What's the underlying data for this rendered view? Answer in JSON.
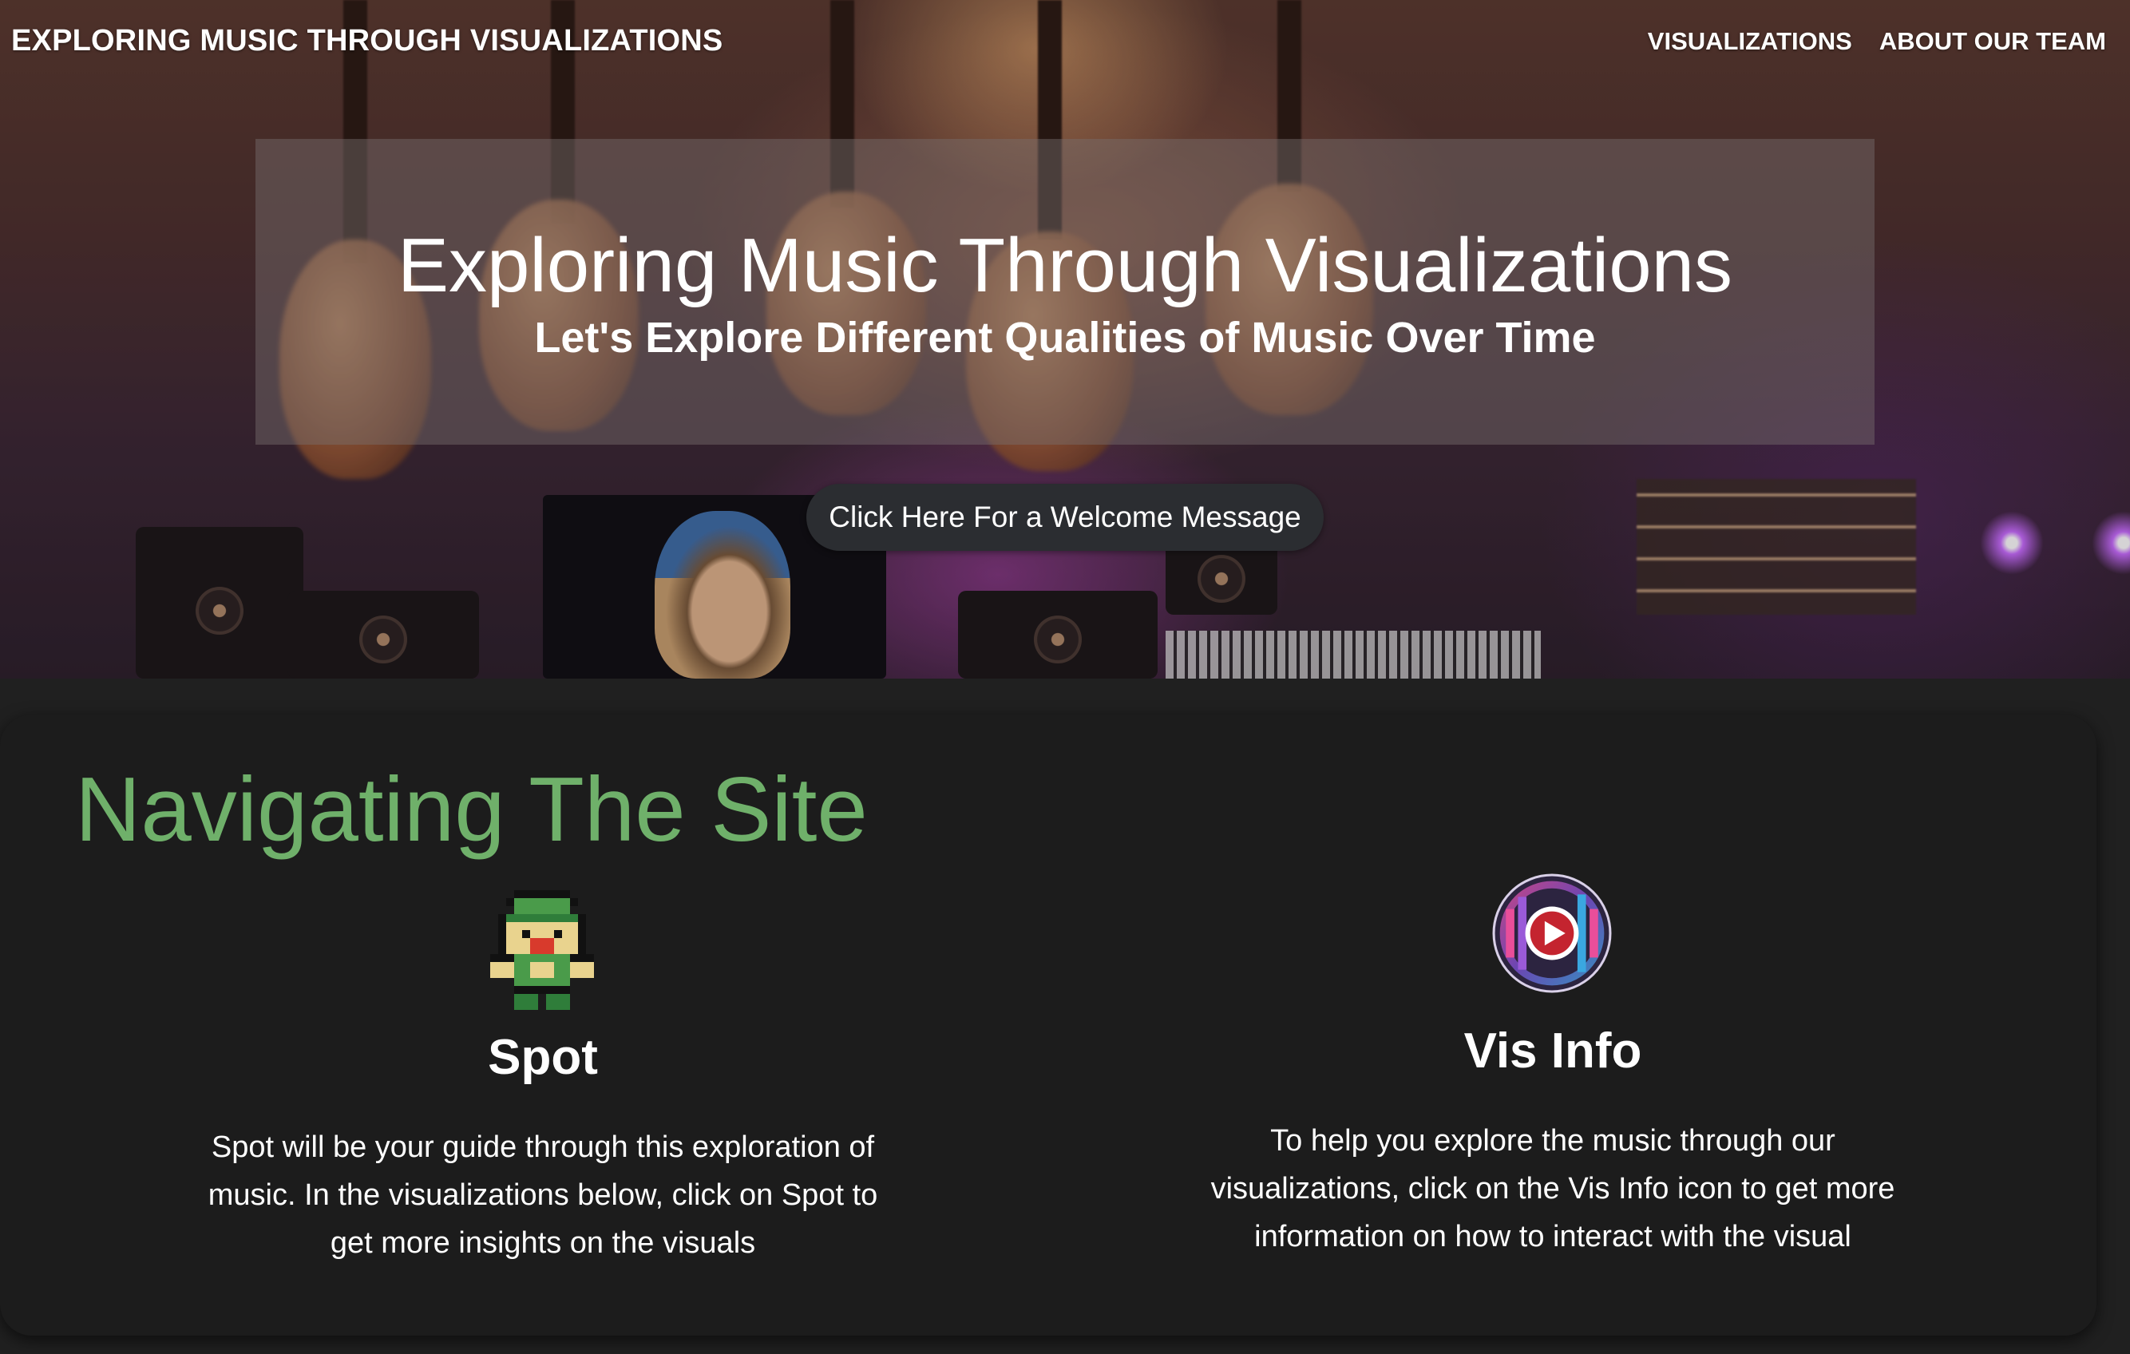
{
  "nav": {
    "brand": "EXPLORING MUSIC THROUGH VISUALIZATIONS",
    "links": [
      "VISUALIZATIONS",
      "ABOUT OUR TEAM"
    ]
  },
  "hero": {
    "title": "Exploring Music Through Visualizations",
    "subtitle": "Let's Explore Different Qualities of Music Over Time",
    "welcome_button": "Click Here For a Welcome Message"
  },
  "navigating": {
    "heading": "Navigating The Site",
    "spot": {
      "icon": "pixel-character-icon",
      "title": "Spot",
      "lines": [
        "Spot will be your guide through this exploration of",
        "music. In the visualizations below, click on Spot to",
        "get more insights on the visuals"
      ]
    },
    "vis_info": {
      "icon": "play-record-icon",
      "title": "Vis Info",
      "lines": [
        "To help you explore the music through our",
        "visualizations, click on the Vis Info icon to get more",
        "information on how to interact with the visual"
      ]
    }
  },
  "colors": {
    "accent_green": "#6fb06a",
    "panel_bg": "#1c1c1c",
    "page_bg": "#202020",
    "button_bg": "#2b2d31"
  }
}
